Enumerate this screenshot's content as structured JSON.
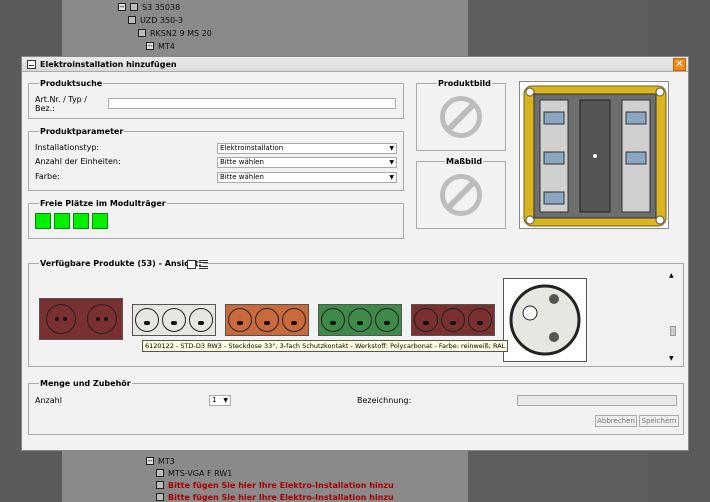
{
  "background_tree": [
    {
      "label": "S3 35038",
      "toggle": "−"
    },
    {
      "label": "UZD 350-3",
      "toggle": ""
    },
    {
      "label": "RKSN2 9 MS 20",
      "toggle": ""
    },
    {
      "label": "MT4",
      "toggle": "−"
    },
    {
      "label": "MT3",
      "toggle": "−"
    },
    {
      "label": "MTS-VGA F RW1",
      "toggle": ""
    },
    {
      "label": "Bitte fügen Sie hier Ihre Elektro-Installation hinzu",
      "toggle": ""
    },
    {
      "label": "Bitte fügen Sie hier Ihre Elektro-Installation hinzu",
      "toggle": ""
    }
  ],
  "dialog": {
    "title": "Elektroinstallation hinzufügen",
    "close_label": "✕"
  },
  "produktsuche": {
    "legend": "Produktsuche",
    "label_line1": "Art.Nr. / Typ /",
    "label_line2": "Bez.:",
    "value": ""
  },
  "produktparameter": {
    "legend": "Produktparameter",
    "rows": [
      {
        "label": "Installationstyp:",
        "value": "Elektroinstallation"
      },
      {
        "label": "Anzahl der Einheiten:",
        "value": "Bitte wählen"
      },
      {
        "label": "Farbe:",
        "value": "Bitte wählen"
      }
    ]
  },
  "freie_plaetze": {
    "legend": "Freie Plätze im Modulträger",
    "count": 4,
    "color": "#00f000"
  },
  "produktbild": {
    "legend": "Produktbild"
  },
  "massbild": {
    "legend": "Maßbild"
  },
  "verfuegbare_produkte": {
    "legend": "Verfügbare Produkte (53) - Ansicht:",
    "products": [
      {
        "color": "#7a3030",
        "sockets": 2
      },
      {
        "color": "#e8e6e0",
        "sockets": 3
      },
      {
        "color": "#c86a3c",
        "sockets": 3
      },
      {
        "color": "#3f8a48",
        "sockets": 3
      },
      {
        "color": "#7a3030",
        "sockets": 3
      }
    ],
    "tooltip": "6120122 - STD-D3 RW3 - Steckdose 33°, 3-fach Schutzkontakt - Werkstoff: Polycarbonat - Farbe: reinweiß; RAL 9010"
  },
  "menge": {
    "legend": "Menge und Zubehör",
    "anzahl_label": "Anzahl",
    "anzahl_value": "1",
    "bezeichnung_label": "Bezeichnung:",
    "bezeichnung_value": "",
    "cancel_label": "Abbrechen",
    "save_label": "Speichern"
  }
}
